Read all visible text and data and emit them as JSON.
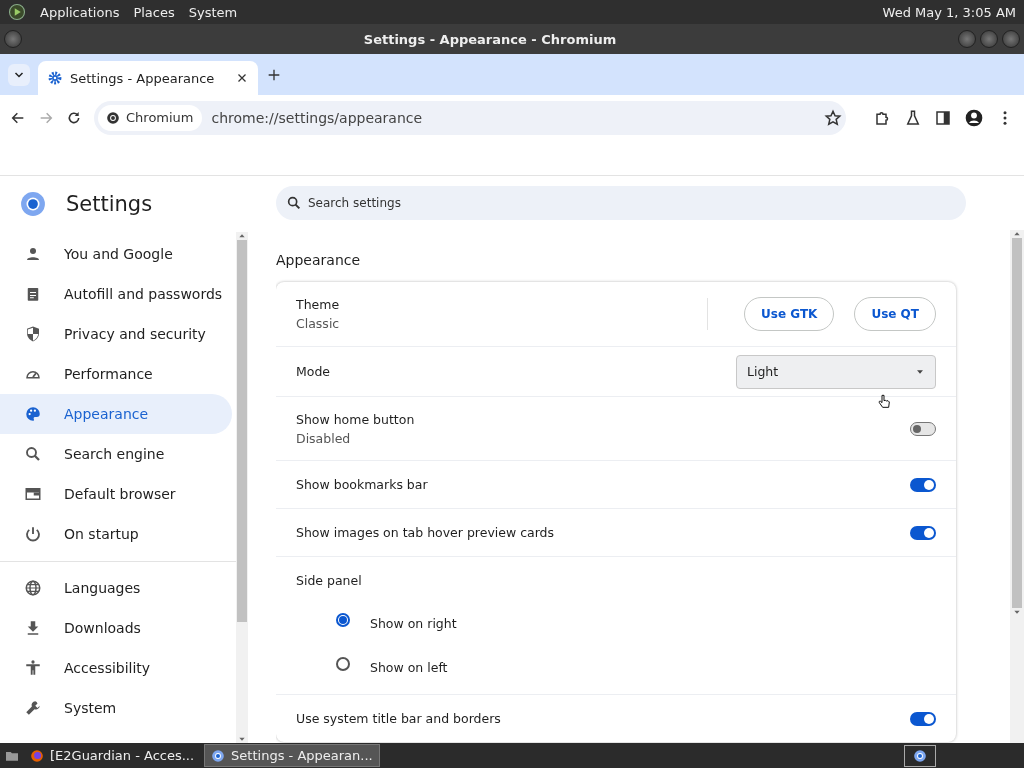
{
  "top_panel": {
    "menus": [
      "Applications",
      "Places",
      "System"
    ],
    "clock": "Wed May 1, 3:05 AM"
  },
  "window": {
    "title": "Settings - Appearance - Chromium"
  },
  "tabs": [
    {
      "label": "Settings - Appearance",
      "selected": true
    }
  ],
  "toolbar": {
    "site_chip": "Chromium",
    "url": "chrome://settings/appearance"
  },
  "settings": {
    "title": "Settings",
    "search": {
      "placeholder": "Search settings"
    },
    "nav_groups": [
      {
        "items": [
          {
            "label": "You and Google",
            "selected": false
          },
          {
            "label": "Autofill and passwords",
            "selected": false
          },
          {
            "label": "Privacy and security",
            "selected": false
          },
          {
            "label": "Performance",
            "selected": false
          },
          {
            "label": "Appearance",
            "selected": true
          },
          {
            "label": "Search engine",
            "selected": false
          },
          {
            "label": "Default browser",
            "selected": false
          },
          {
            "label": "On startup",
            "selected": false
          }
        ]
      },
      {
        "items": [
          {
            "label": "Languages",
            "selected": false
          },
          {
            "label": "Downloads",
            "selected": false
          },
          {
            "label": "Accessibility",
            "selected": false
          },
          {
            "label": "System",
            "selected": false
          }
        ]
      }
    ],
    "section": "Appearance",
    "rows": [
      {
        "kind": "theme",
        "label": "Theme",
        "value": "Classic",
        "buttons": [
          "Use GTK",
          "Use QT"
        ]
      },
      {
        "kind": "select",
        "label": "Mode",
        "value": "Light"
      },
      {
        "kind": "toggle",
        "label": "Show home button",
        "sublabel": "Disabled",
        "on": false
      },
      {
        "kind": "toggle",
        "label": "Show bookmarks bar",
        "on": true
      },
      {
        "kind": "toggle",
        "label": "Show images on tab hover preview cards",
        "on": true
      },
      {
        "kind": "radio_group",
        "label": "Side panel",
        "options": [
          {
            "label": "Show on right",
            "selected": true
          },
          {
            "label": "Show on left",
            "selected": false
          }
        ]
      },
      {
        "kind": "toggle",
        "label": "Use system title bar and borders",
        "on": true
      }
    ]
  },
  "taskbar": {
    "tasks": [
      {
        "label": "[E2Guardian - Acces...",
        "selected": false
      },
      {
        "label": "Settings - Appearan...",
        "selected": true
      }
    ]
  }
}
